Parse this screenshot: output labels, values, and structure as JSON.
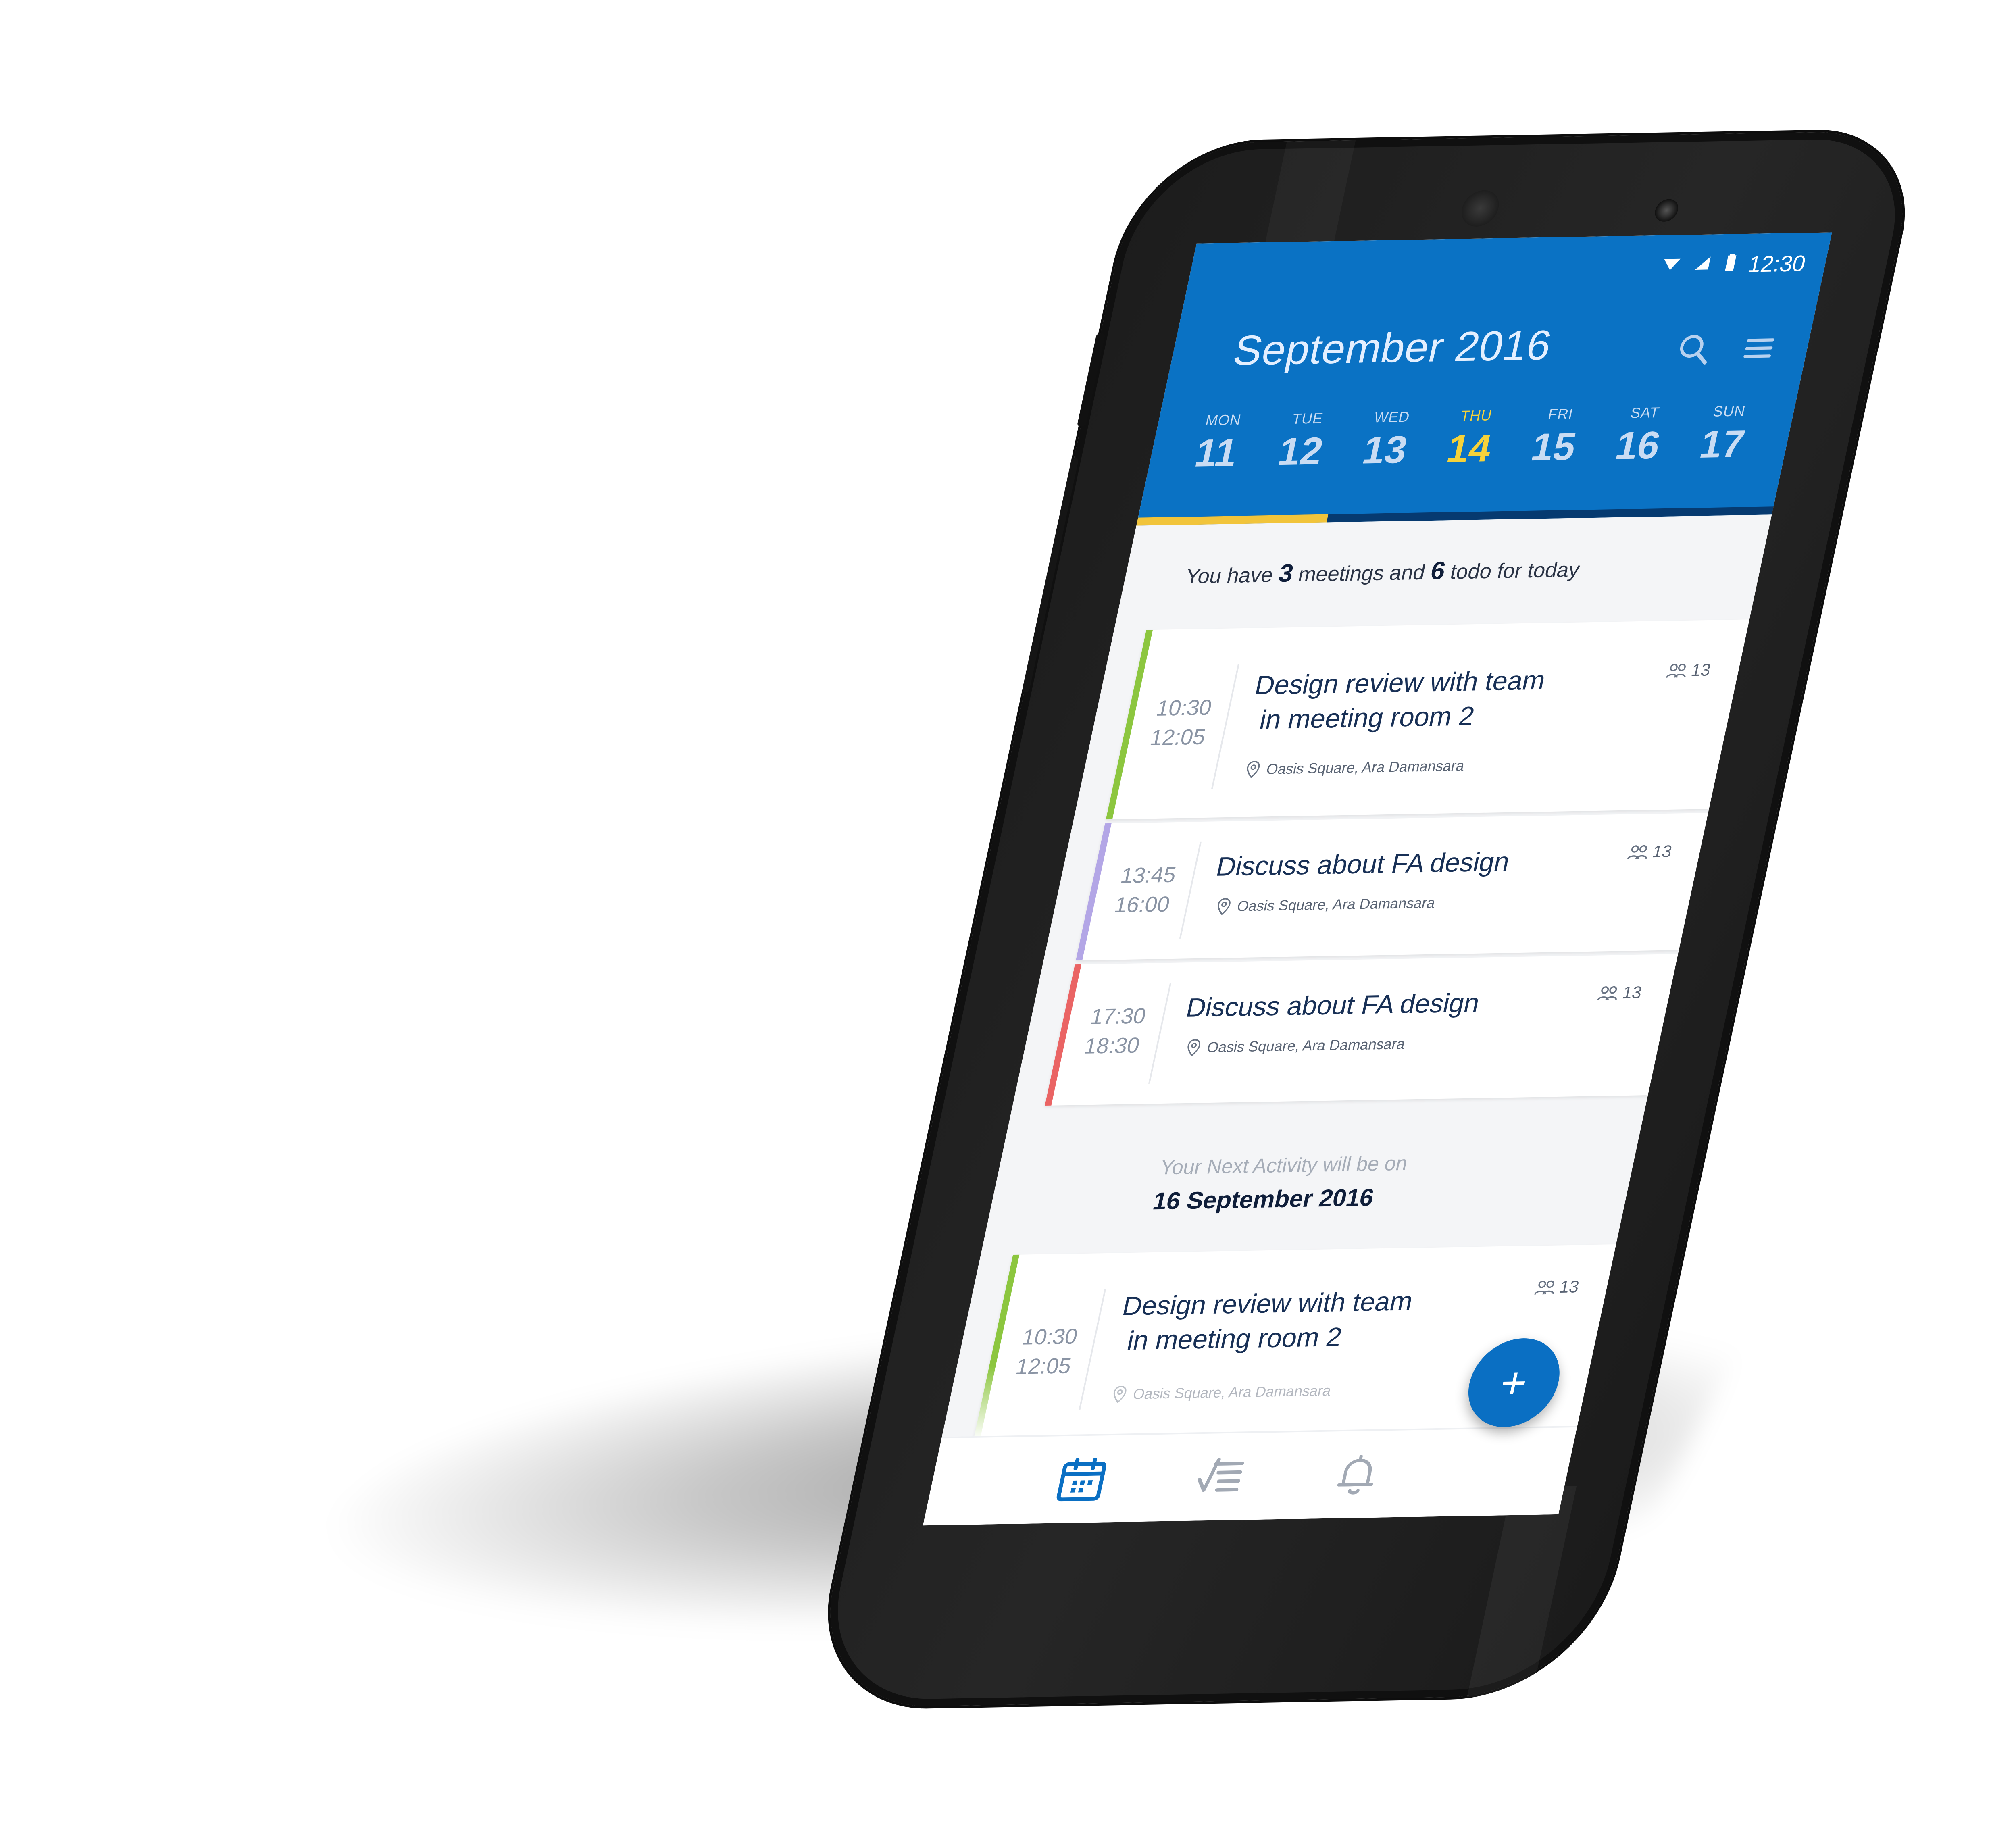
{
  "status_bar": {
    "time": "12:30"
  },
  "header": {
    "title": "September 2016"
  },
  "week": [
    {
      "name": "MON",
      "num": "11"
    },
    {
      "name": "TUE",
      "num": "12"
    },
    {
      "name": "WED",
      "num": "13"
    },
    {
      "name": "THU",
      "num": "14",
      "active": true
    },
    {
      "name": "FRI",
      "num": "15"
    },
    {
      "name": "SAT",
      "num": "16"
    },
    {
      "name": "SUN",
      "num": "17"
    }
  ],
  "summary": {
    "prefix": "You have",
    "meetings": "3",
    "middle": "meetings and",
    "todos": "6",
    "suffix": "todo for today"
  },
  "events_today": [
    {
      "start": "10:30",
      "end": "12:05",
      "title_line1": "Design review with team",
      "title_line2": "in meeting room 2",
      "location": "Oasis Square, Ara Damansara",
      "attendees": "13",
      "color": "#8cc63f"
    },
    {
      "start": "13:45",
      "end": "16:00",
      "title_line1": "Discuss about FA design",
      "location": "Oasis Square, Ara Damansara",
      "attendees": "13",
      "color": "#b3a6e6"
    },
    {
      "start": "17:30",
      "end": "18:30",
      "title_line1": "Discuss about FA design",
      "location": "Oasis Square, Ara Damansara",
      "attendees": "13",
      "color": "#ea6464"
    }
  ],
  "next": {
    "label": "Your Next Activity will be on",
    "date": "16 September 2016",
    "event": {
      "start": "10:30",
      "end": "12:05",
      "title_line1": "Design review with team",
      "title_line2": "in meeting room 2",
      "location": "Oasis Square, Ara Damansara",
      "attendees": "13",
      "color": "#8cc63f"
    }
  },
  "fab": {
    "label": "+"
  },
  "bottom_nav": [
    {
      "icon": "calendar-icon",
      "active": true
    },
    {
      "icon": "todo-list-icon",
      "active": false
    },
    {
      "icon": "bell-icon",
      "active": false
    }
  ],
  "colors": {
    "primary": "#0a72c4",
    "accent": "#f1c43b"
  }
}
